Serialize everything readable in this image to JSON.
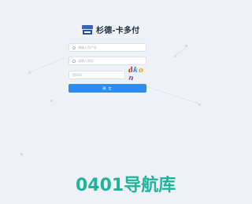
{
  "brand": {
    "title": "杉德-卡多付",
    "logo_icon": "card-logo-icon"
  },
  "login": {
    "username_placeholder": "请输入用户名",
    "password_placeholder": "请输入密码",
    "captcha_placeholder": "验证码",
    "captcha_text": "dkon",
    "submit_label": "确 定"
  },
  "watermark": {
    "text": "0401导航库"
  },
  "colors": {
    "accent": "#2d8cf0",
    "watermark": "#20b39b",
    "background": "#eef1f6"
  }
}
